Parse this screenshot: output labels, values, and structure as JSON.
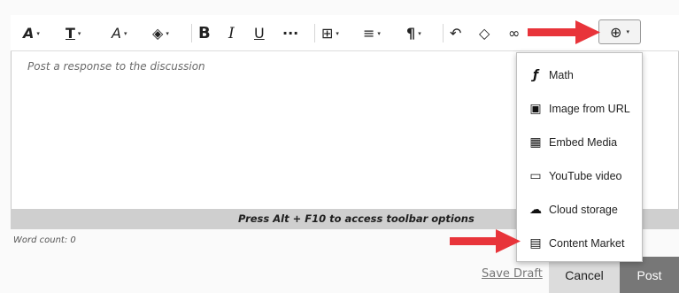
{
  "toolbar": {
    "buttons": [
      {
        "name": "text-style",
        "glyph": "A",
        "dropdown": true
      },
      {
        "name": "font-family",
        "glyph": "T",
        "dropdown": true
      },
      {
        "name": "font-size",
        "glyph": "A",
        "dropdown": true
      },
      {
        "name": "text-color",
        "glyph": "◈",
        "dropdown": true
      },
      {
        "name": "bold",
        "glyph": "B"
      },
      {
        "name": "italic",
        "glyph": "I"
      },
      {
        "name": "underline",
        "glyph": "U"
      },
      {
        "name": "more-formatting",
        "glyph": "···"
      },
      {
        "name": "table",
        "glyph": "⊞",
        "dropdown": true
      },
      {
        "name": "align",
        "glyph": "≡",
        "dropdown": true
      },
      {
        "name": "paragraph",
        "glyph": "¶",
        "dropdown": true
      },
      {
        "name": "undo",
        "glyph": "↶"
      },
      {
        "name": "clear-formatting",
        "glyph": "◇"
      },
      {
        "name": "link",
        "glyph": "∞"
      }
    ],
    "insert_glyph": "⊕",
    "dropdown_caret": "▾"
  },
  "editor": {
    "placeholder": "Post a response to the discussion",
    "hint": "Press Alt + F10 to access toolbar options",
    "word_count": "Word count: 0"
  },
  "insert_menu": {
    "items": [
      {
        "label": "Math",
        "icon": "math-icon",
        "glyph": "ƒ"
      },
      {
        "label": "Image from URL",
        "icon": "image-url-icon",
        "glyph": "▣"
      },
      {
        "label": "Embed Media",
        "icon": "embed-media-icon",
        "glyph": "▦"
      },
      {
        "label": "YouTube video",
        "icon": "youtube-icon",
        "glyph": "▭"
      },
      {
        "label": "Cloud storage",
        "icon": "cloud-storage-icon",
        "glyph": "☁"
      },
      {
        "label": "Content Market",
        "icon": "content-market-icon",
        "glyph": "▤"
      }
    ]
  },
  "actions": {
    "save_draft": "Save Draft",
    "cancel": "Cancel",
    "post": "Post"
  },
  "colors": {
    "arrow": "#e8343a",
    "hint_bar": "#cfcfcf",
    "post_button": "#777777",
    "cancel_button": "#dcdcdc"
  }
}
